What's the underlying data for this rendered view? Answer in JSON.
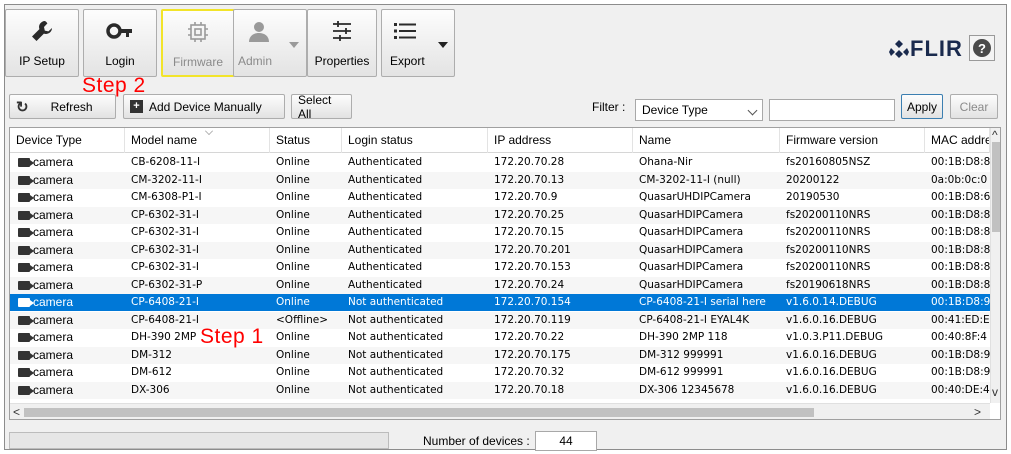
{
  "toolbar": {
    "buttons": [
      {
        "label": "IP Setup",
        "icon": "wrench-icon"
      },
      {
        "label": "Login",
        "icon": "key-icon"
      },
      {
        "label": "Firmware",
        "icon": "chip-icon"
      },
      {
        "label": "Admin",
        "icon": "user-icon"
      },
      {
        "label": "Properties",
        "icon": "sliders-icon"
      },
      {
        "label": "Export",
        "icon": "list-icon"
      }
    ],
    "logo": "FLIR",
    "help": "?"
  },
  "annotations": {
    "step1": "Step 1",
    "step2": "Step 2"
  },
  "actions": {
    "refresh": "Refresh",
    "add_device": "Add Device Manually",
    "select_all": "Select All",
    "filter_label": "Filter :",
    "filter_type": "Device Type",
    "filter_value": "",
    "apply": "Apply",
    "clear": "Clear"
  },
  "table": {
    "columns": [
      "Device Type",
      "Model name",
      "Status",
      "Login status",
      "IP address",
      "Name",
      "Firmware version",
      "MAC addre"
    ],
    "rows": [
      [
        "camera",
        "CB-6208-11-I",
        "Online",
        "Authenticated",
        "172.20.70.28",
        "Ohana-Nir",
        "fs20160805NSZ",
        "00:1B:D8:8"
      ],
      [
        "camera",
        "CM-3202-11-I",
        "Online",
        "Authenticated",
        "172.20.70.13",
        "CM-3202-11-I (null)",
        "20200122",
        "0a:0b:0c:0"
      ],
      [
        "camera",
        "CM-6308-P1-I",
        "Online",
        "Authenticated",
        "172.20.70.9",
        "QuasarUHDIPCamera",
        "20190530",
        "00:1B:D8:6"
      ],
      [
        "camera",
        "CP-6302-31-I",
        "Online",
        "Authenticated",
        "172.20.70.25",
        "QuasarHDIPCamera",
        "fs20200110NRS",
        "00:1B:D8:8"
      ],
      [
        "camera",
        "CP-6302-31-I",
        "Online",
        "Authenticated",
        "172.20.70.15",
        "QuasarHDIPCamera",
        "fs20200110NRS",
        "00:1B:D8:8"
      ],
      [
        "camera",
        "CP-6302-31-I",
        "Online",
        "Authenticated",
        "172.20.70.201",
        "QuasarHDIPCamera",
        "fs20200110NRS",
        "00:1B:D8:8"
      ],
      [
        "camera",
        "CP-6302-31-I",
        "Online",
        "Authenticated",
        "172.20.70.153",
        "QuasarHDIPCamera",
        "fs20200110NRS",
        "00:1B:D8:8"
      ],
      [
        "camera",
        "CP-6302-31-P",
        "Online",
        "Authenticated",
        "172.20.70.24",
        "QuasarHDIPCamera",
        "fs20190618NRS",
        "00:1B:D8:8"
      ],
      [
        "camera",
        "CP-6408-21-I",
        "Online",
        "Not authenticated",
        "172.20.70.154",
        "CP-6408-21-I serial here",
        "v1.6.0.14.DEBUG",
        "00:1B:D8:9"
      ],
      [
        "camera",
        "CP-6408-21-I",
        "<Offline>",
        "Not authenticated",
        "172.20.70.119",
        "CP-6408-21-I EYAL4K",
        "v1.6.0.16.DEBUG",
        "00:41:ED:E"
      ],
      [
        "camera",
        "DH-390 2MP",
        "Online",
        "Not authenticated",
        "172.20.70.22",
        "DH-390 2MP 118",
        "v1.0.3.P11.DEBUG",
        "00:40:8F:4"
      ],
      [
        "camera",
        "DM-312",
        "Online",
        "Not authenticated",
        "172.20.70.175",
        "DM-312 999991",
        "v1.6.0.16.DEBUG",
        "00:1B:D8:9"
      ],
      [
        "camera",
        "DM-612",
        "Online",
        "Not authenticated",
        "172.20.70.32",
        "DM-612 999991",
        "v1.6.0.16.DEBUG",
        "00:1B:D8:9"
      ],
      [
        "camera",
        "DX-306",
        "Online",
        "Not authenticated",
        "172.20.70.18",
        "DX-306 12345678",
        "v1.6.0.16.DEBUG",
        "00:40:DE:4"
      ]
    ],
    "selected_row": 8
  },
  "status": {
    "count_label": "Number of devices :",
    "count": "44"
  }
}
